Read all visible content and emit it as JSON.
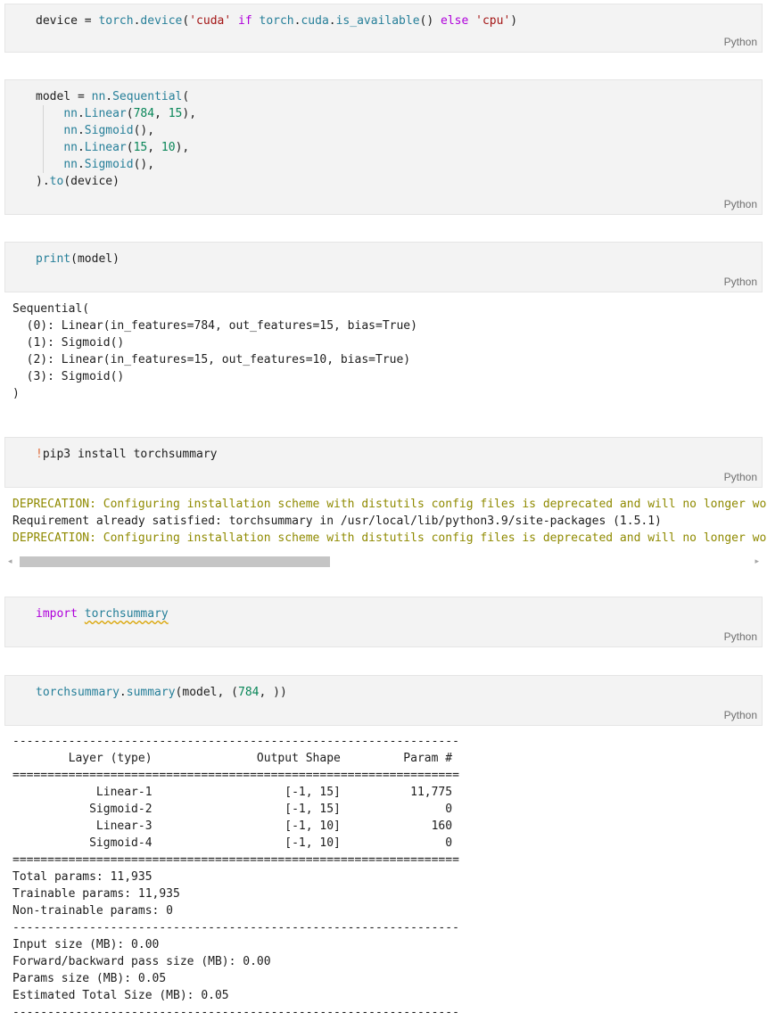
{
  "language_label": "Python",
  "cells": {
    "c1": {
      "tokens": [
        "device = ",
        "torch",
        ".",
        "device",
        "(",
        "'cuda'",
        " ",
        "if",
        " ",
        "torch",
        ".",
        "cuda",
        ".",
        "is_available",
        "() ",
        "else",
        " ",
        "'cpu'",
        ")"
      ]
    },
    "c2": {
      "l1": [
        "model = ",
        "nn",
        ".",
        "Sequential",
        "("
      ],
      "l2": [
        "nn",
        ".",
        "Linear",
        "(",
        "784",
        ", ",
        "15",
        "),"
      ],
      "l3": [
        "nn",
        ".",
        "Sigmoid",
        "(),"
      ],
      "l4": [
        "nn",
        ".",
        "Linear",
        "(",
        "15",
        ", ",
        "10",
        "),"
      ],
      "l5": [
        "nn",
        ".",
        "Sigmoid",
        "(),"
      ],
      "l6": [
        ").",
        "to",
        "(device)"
      ]
    },
    "c3": {
      "tokens": [
        "print",
        "(model)"
      ]
    },
    "c4": {
      "tokens": [
        "!",
        "pip3 install torchsummary"
      ]
    },
    "c5": {
      "tokens": [
        "import",
        " ",
        "torchsummary"
      ]
    },
    "c6": {
      "tokens": [
        "torchsummary",
        ".",
        "summary",
        "(model, (",
        "784",
        ", ))"
      ]
    }
  },
  "outputs": {
    "print_model": "Sequential(\n  (0): Linear(in_features=784, out_features=15, bias=True)\n  (1): Sigmoid()\n  (2): Linear(in_features=15, out_features=10, bias=True)\n  (3): Sigmoid()\n)",
    "pip_deprecation_1": "DEPRECATION: Configuring installation scheme with distutils config files is deprecated and will no longer work",
    "pip_requirement": "Requirement already satisfied: torchsummary in /usr/local/lib/python3.9/site-packages (1.5.1)",
    "pip_deprecation_2": "DEPRECATION: Configuring installation scheme with distutils config files is deprecated and will no longer work",
    "summary": "----------------------------------------------------------------\n        Layer (type)               Output Shape         Param #\n================================================================\n            Linear-1                   [-1, 15]          11,775\n           Sigmoid-2                   [-1, 15]               0\n            Linear-3                   [-1, 10]             160\n           Sigmoid-4                   [-1, 10]               0\n================================================================\nTotal params: 11,935\nTrainable params: 11,935\nNon-trainable params: 0\n----------------------------------------------------------------\nInput size (MB): 0.00\nForward/backward pass size (MB): 0.00\nParams size (MB): 0.05\nEstimated Total Size (MB): 0.05\n----------------------------------------------------------------"
  },
  "icons": {
    "scroll_left": "◂",
    "scroll_right": "▸"
  }
}
